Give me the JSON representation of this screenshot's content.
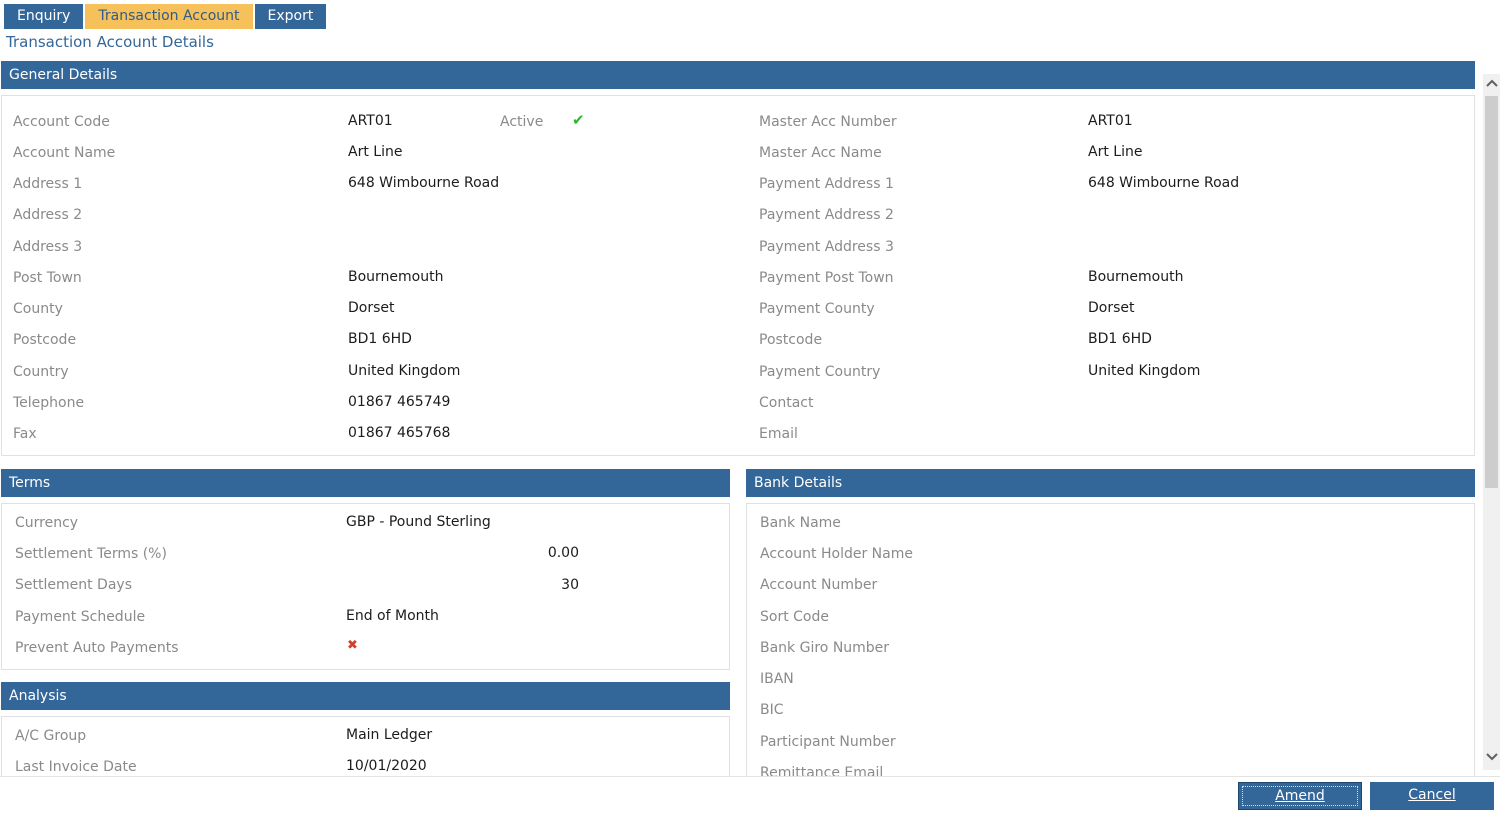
{
  "tabs": [
    "Enquiry",
    "Transaction Account",
    "Export"
  ],
  "page_title": "Transaction Account Details",
  "general": {
    "header": "General Details",
    "active_label": "Active",
    "left": [
      {
        "label": "Account Code",
        "value": "ART01"
      },
      {
        "label": "Account Name",
        "value": "Art Line"
      },
      {
        "label": "Address 1",
        "value": "648 Wimbourne Road"
      },
      {
        "label": "Address 2",
        "value": ""
      },
      {
        "label": "Address 3",
        "value": ""
      },
      {
        "label": "Post Town",
        "value": "Bournemouth"
      },
      {
        "label": "County",
        "value": "Dorset"
      },
      {
        "label": "Postcode",
        "value": "BD1 6HD"
      },
      {
        "label": "Country",
        "value": "United Kingdom"
      },
      {
        "label": "Telephone",
        "value": "01867 465749"
      },
      {
        "label": "Fax",
        "value": "01867 465768"
      }
    ],
    "right": [
      {
        "label": "Master Acc Number",
        "value": "ART01"
      },
      {
        "label": "Master Acc Name",
        "value": "Art Line"
      },
      {
        "label": "Payment Address 1",
        "value": "648 Wimbourne Road"
      },
      {
        "label": "Payment Address 2",
        "value": ""
      },
      {
        "label": "Payment Address 3",
        "value": ""
      },
      {
        "label": "Payment Post Town",
        "value": "Bournemouth"
      },
      {
        "label": "Payment County",
        "value": "Dorset"
      },
      {
        "label": "Postcode",
        "value": "BD1 6HD"
      },
      {
        "label": "Payment Country",
        "value": "United Kingdom"
      },
      {
        "label": "Contact",
        "value": ""
      },
      {
        "label": "Email",
        "value": ""
      }
    ]
  },
  "terms": {
    "header": "Terms",
    "rows": [
      {
        "label": "Currency",
        "value": "GBP - Pound Sterling"
      },
      {
        "label": "Settlement Terms (%)",
        "value": "0.00"
      },
      {
        "label": "Settlement Days",
        "value": "30"
      },
      {
        "label": "Payment Schedule",
        "value": "End of Month"
      },
      {
        "label": "Prevent Auto Payments",
        "value": ""
      }
    ]
  },
  "bank": {
    "header": "Bank Details",
    "rows": [
      {
        "label": "Bank Name"
      },
      {
        "label": "Account Holder Name"
      },
      {
        "label": "Account Number"
      },
      {
        "label": "Sort Code"
      },
      {
        "label": "Bank Giro Number"
      },
      {
        "label": "IBAN"
      },
      {
        "label": "BIC"
      },
      {
        "label": "Participant Number"
      },
      {
        "label": "Remittance Email"
      }
    ]
  },
  "analysis": {
    "header": "Analysis",
    "rows": [
      {
        "label": "A/C Group",
        "value": "Main Ledger"
      },
      {
        "label": "Last Invoice Date",
        "value": "10/01/2020"
      }
    ]
  },
  "icons": {
    "active": "check-icon",
    "prevent_auto_payments": "cross-icon",
    "scroll_up": "chevron-up-icon",
    "scroll_down": "chevron-down-icon"
  },
  "colors": {
    "header_blue": "#336699",
    "active_tab": "#f6c05b",
    "check_green": "#2fb52f",
    "cross_red": "#d0402a"
  },
  "buttons": {
    "amend": "Amend",
    "cancel": "Cancel"
  }
}
